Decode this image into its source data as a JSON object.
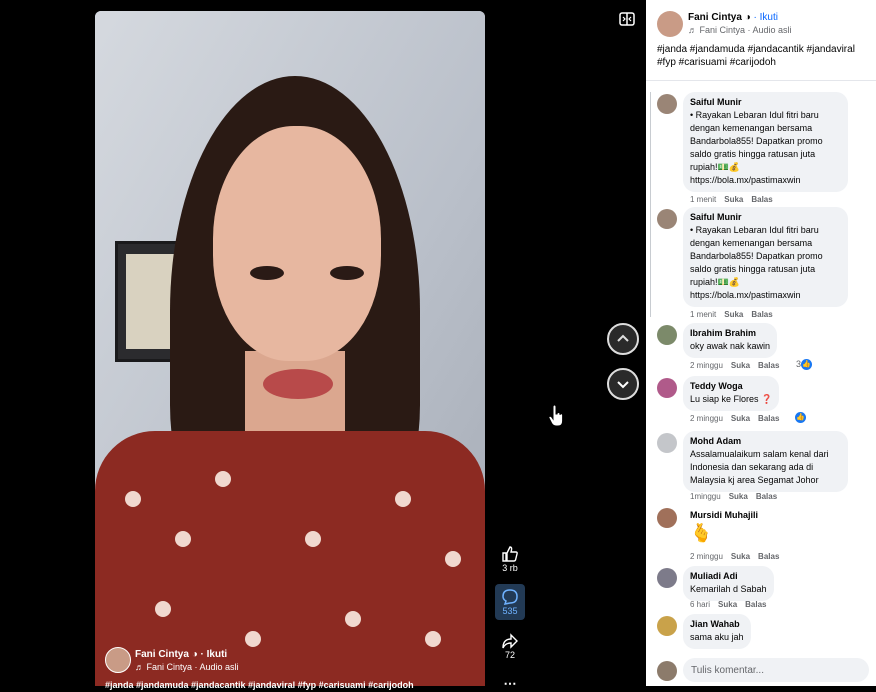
{
  "video": {
    "author": "Fani Cintya",
    "follow": "· Ikuti",
    "audio": "♬ Fani Cintya · Audio asli",
    "caption_preview": "#janda #jandamuda #jandacantik #jandaviral #fyp #carisuami #carijodoh"
  },
  "actions": {
    "likes": "3 rb",
    "comments": "535",
    "shares": "72"
  },
  "panel": {
    "author": "Fani Cintya",
    "follow": "· Ikuti",
    "audio": "♬ Fani Cintya · Audio asli",
    "hashtags": "#janda #jandamuda #jandacantik #jandaviral #fyp #carisuami #carijodoh"
  },
  "comments": [
    {
      "author": "Saiful Munir",
      "text": "• Rayakan Lebaran Idul fitri baru dengan kemenangan bersama Bandarbola855! Dapatkan promo saldo gratis hingga ratusan juta rupiah!💵💰 https://bola.mx/pastimaxwin",
      "time": "1 menit",
      "like": "Suka",
      "reply": "Balas"
    },
    {
      "author": "Saiful Munir",
      "text": "• Rayakan Lebaran Idul fitri baru dengan kemenangan bersama Bandarbola855! Dapatkan promo saldo gratis hingga ratusan juta rupiah!💵💰 https://bola.mx/pastimaxwin",
      "time": "1 menit",
      "like": "Suka",
      "reply": "Balas"
    },
    {
      "author": "Ibrahim Brahim",
      "text": "oky awak nak kawin",
      "time": "2 minggu",
      "like": "Suka",
      "reply": "Balas",
      "reactions": "3"
    },
    {
      "author": "Teddy Woga",
      "text": "Lu siap ke Flores ❓",
      "time": "2 minggu",
      "like": "Suka",
      "reply": "Balas",
      "reactions": ""
    },
    {
      "author": "Mohd Adam",
      "text": "Assalamualaikum salam kenal dari Indonesia dan sekarang ada di Malaysia kj area Segamat Johor",
      "time": "1minggu",
      "like": "Suka",
      "reply": "Balas"
    },
    {
      "author": "Mursidi Muhajili",
      "text": "🫰",
      "time": "2 minggu",
      "like": "Suka",
      "reply": "Balas"
    },
    {
      "author": "Muliadi Adi",
      "text": "Kemarilah d Sabah",
      "time": "6 hari",
      "like": "Suka",
      "reply": "Balas"
    },
    {
      "author": "Jian Wahab",
      "text": "sama aku jah",
      "time": "",
      "like": "",
      "reply": ""
    }
  ],
  "composer": {
    "placeholder": "Tulis komentar..."
  },
  "colors": {
    "accent": "#0866ff",
    "like_blue": "#1877f2",
    "bubble_bg": "#f0f2f5"
  }
}
